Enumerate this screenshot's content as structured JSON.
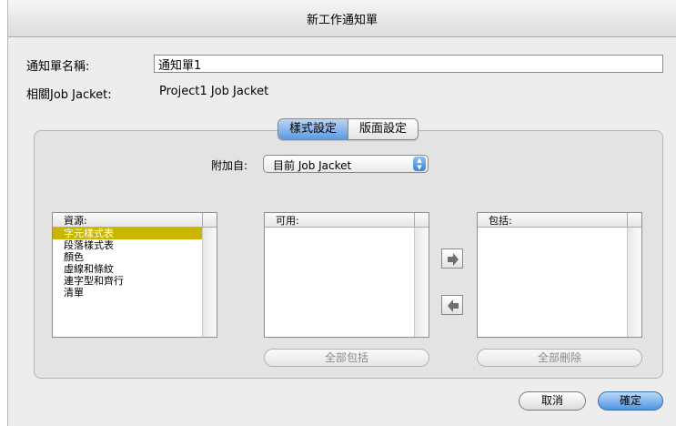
{
  "dialog": {
    "title": "新工作通知單"
  },
  "form": {
    "name_label": "通知單名稱:",
    "name_value": "通知單1",
    "related_label": "相關Job Jacket:",
    "related_value": "Project1 Job Jacket"
  },
  "tabs": [
    {
      "label": "樣式設定",
      "active": true
    },
    {
      "label": "版面設定",
      "active": false
    }
  ],
  "source": {
    "label": "附加自:",
    "selected": "目前 Job Jacket"
  },
  "resources_list": {
    "header": "資源:",
    "items": [
      "字元樣式表",
      "段落樣式表",
      "顏色",
      "虛線和條紋",
      "連字型和齊行",
      "清單"
    ],
    "selected_index": 0,
    "selected_color": "#c9b600"
  },
  "available_list": {
    "header": "可用:",
    "items": []
  },
  "included_list": {
    "header": "包括:",
    "items": []
  },
  "buttons": {
    "include_all": "全部包括",
    "remove_all": "全部刪除",
    "cancel": "取消",
    "ok": "確定",
    "add_arrow_icon": "arrow-right-icon",
    "remove_arrow_icon": "arrow-left-icon"
  }
}
